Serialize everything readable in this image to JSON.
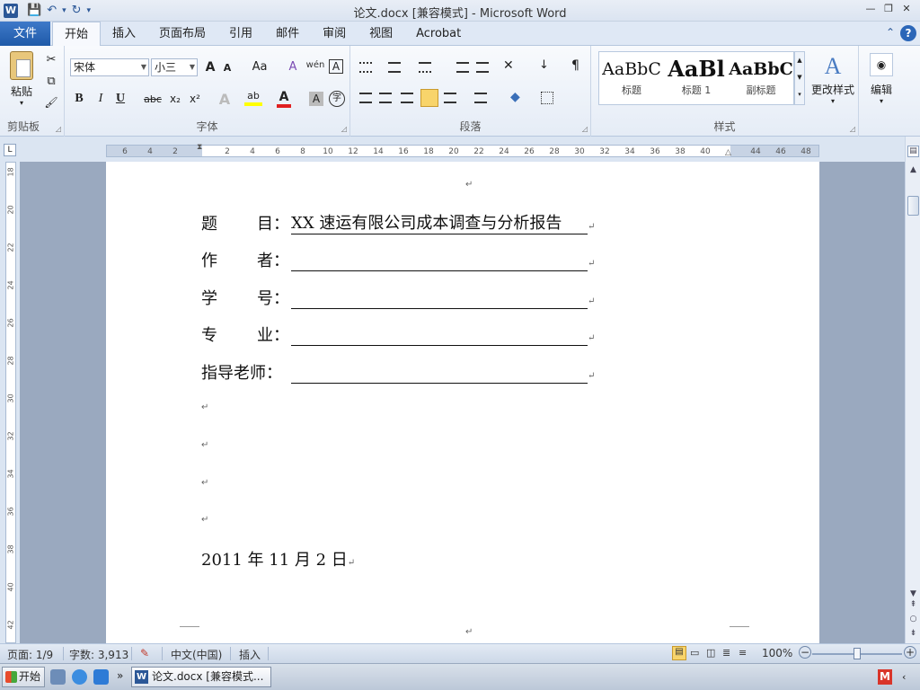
{
  "window": {
    "title": "论文.docx [兼容模式] - Microsoft Word",
    "app_logo": "W",
    "qat": {
      "save": "💾",
      "undo": "↶",
      "undo_arrow": "▾",
      "redo": "↻",
      "customize": "▾"
    },
    "controls": {
      "minimize": "—",
      "restore": "❐",
      "close": "✕"
    }
  },
  "tabs": {
    "file": "文件",
    "items": [
      "开始",
      "插入",
      "页面布局",
      "引用",
      "邮件",
      "审阅",
      "视图",
      "Acrobat"
    ],
    "active_index": 0,
    "collapse": "⌃",
    "help": "?"
  },
  "ribbon": {
    "clipboard": {
      "label": "剪贴板",
      "paste": "粘贴",
      "cut": "✂",
      "copy": "⧉",
      "painter": "🖌"
    },
    "font": {
      "label": "字体",
      "font_name": "宋体",
      "font_size": "小三",
      "grow": "A",
      "shrink": "A",
      "case": "Aa",
      "clear": "A",
      "phonetic": "wén",
      "border": "A",
      "bold": "B",
      "italic": "I",
      "underline": "U",
      "strike": "abc",
      "sub": "x₂",
      "sup": "x²",
      "effects": "A",
      "highlight": "ab",
      "color": "A",
      "shading": "A",
      "enclose": "字"
    },
    "paragraph": {
      "label": "段落",
      "show_marks": "¶"
    },
    "styles": {
      "label": "样式",
      "items": [
        {
          "preview": "AaBbC",
          "name": "标题"
        },
        {
          "preview": "AaBl",
          "name": "标题 1"
        },
        {
          "preview": "AaBbC",
          "name": "副标题"
        }
      ],
      "change": "更改样式"
    },
    "editing": {
      "label": "编辑"
    }
  },
  "ruler": {
    "ticks": [
      "6",
      "4",
      "2",
      "2",
      "4",
      "6",
      "8",
      "10",
      "12",
      "14",
      "16",
      "18",
      "20",
      "22",
      "24",
      "26",
      "28",
      "30",
      "32",
      "34",
      "36",
      "38",
      "40",
      "44",
      "46",
      "48"
    ],
    "vticks": [
      "18",
      "20",
      "22",
      "24",
      "26",
      "28",
      "30",
      "32",
      "34",
      "36",
      "38",
      "40",
      "42"
    ]
  },
  "document": {
    "top_mark": "↵",
    "fields": [
      {
        "label_a": "题",
        "label_b": "目",
        "colon": "：",
        "value": "XX 速运有限公司成本调查与分析报告"
      },
      {
        "label_a": "作",
        "label_b": "者",
        "colon": "：",
        "value": ""
      },
      {
        "label_a": "学",
        "label_b": "号",
        "colon": "：",
        "value": ""
      },
      {
        "label_a": "专",
        "label_b": "业",
        "colon": "：",
        "value": ""
      },
      {
        "label_full": "指导老师",
        "colon": "：",
        "value": ""
      }
    ],
    "para_mark": "↵",
    "date": "2011 年 11 月 2 日"
  },
  "status": {
    "page": "页面: 1/9",
    "words": "字数: 3,913",
    "language": "中文(中国)",
    "mode": "插入",
    "zoom": "100%",
    "zoom_out": "−",
    "zoom_in": "+"
  },
  "taskbar": {
    "start": "开始",
    "more": "»",
    "word_task": "论文.docx [兼容模式...",
    "tray_m": "M",
    "tray_arrow": "‹"
  }
}
